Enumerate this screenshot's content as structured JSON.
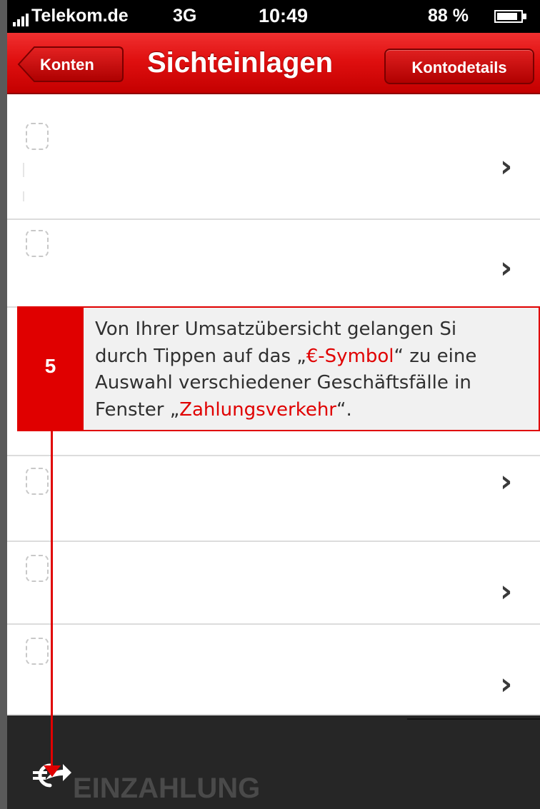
{
  "status_bar": {
    "carrier": "Telekom.de",
    "network": "3G",
    "time": "10:49",
    "battery": "88 %"
  },
  "nav": {
    "back_label": "Konten",
    "title": "Sichteinlagen",
    "right_button_label": "Kontodetails"
  },
  "list": {
    "row_count": 6,
    "chevron": "›"
  },
  "callout": {
    "step_number": "5",
    "line1": "Von Ihrer Umsatzübersicht gelangen Si",
    "line2_prefix": "durch Tippen auf das „",
    "line2_highlight": "€-Symbol",
    "line2_suffix": "“ zu eine",
    "line3": "Auswahl verschiedener Geschäftsfälle in",
    "line4_prefix": "Fenster „",
    "line4_highlight": "Zahlungsverkehr",
    "line4_suffix": "“.",
    "accent_color": "#e00000"
  },
  "tab_bar": {
    "icon": "euro-transfer-icon",
    "label": "EINZAHLUNG"
  },
  "colors": {
    "nav_red": "#e01010",
    "tab_bar_bg": "#262626"
  }
}
